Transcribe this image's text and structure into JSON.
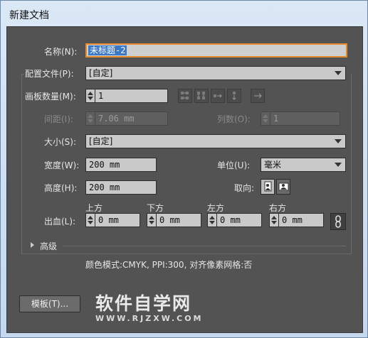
{
  "window": {
    "title": "新建文档"
  },
  "name": {
    "label": "名称(N):",
    "value": "未标题-2"
  },
  "profile": {
    "label": "配置文件(P):",
    "value": "[自定]"
  },
  "artboards": {
    "label": "画板数量(M):",
    "value": "1"
  },
  "spacing": {
    "label": "间距(I):",
    "value": "7.06 mm"
  },
  "columns": {
    "label": "列数(O):",
    "value": "1"
  },
  "size": {
    "label": "大小(S):",
    "value": "[自定]"
  },
  "width": {
    "label": "宽度(W):",
    "value": "200 mm"
  },
  "units": {
    "label": "单位(U):",
    "value": "毫米"
  },
  "height": {
    "label": "高度(H):",
    "value": "200 mm"
  },
  "orientation": {
    "label": "取向:",
    "selected": "portrait"
  },
  "bleed": {
    "label": "出血(L):",
    "top": {
      "label": "上方",
      "value": "0 mm"
    },
    "bottom": {
      "label": "下方",
      "value": "0 mm"
    },
    "left": {
      "label": "左方",
      "value": "0 mm"
    },
    "right": {
      "label": "右方",
      "value": "0 mm"
    }
  },
  "advanced": {
    "label": "高级"
  },
  "summary": "颜色模式:CMYK, PPI:300, 对齐像素网格:否",
  "template_button": "模板(T)...",
  "watermark": {
    "main": "软件自学网",
    "sub": "WWW.RJZXW.COM"
  },
  "colors": {
    "panel": "#535353",
    "focus_border": "#e48a2a",
    "selection": "#3a78c8"
  },
  "icons": [
    "grid-by-row-icon",
    "grid-by-column-icon",
    "arrange-by-row-icon",
    "arrange-by-column-icon",
    "right-to-left-icon",
    "portrait-icon",
    "landscape-icon",
    "link-icon",
    "disclosure-triangle-icon"
  ]
}
